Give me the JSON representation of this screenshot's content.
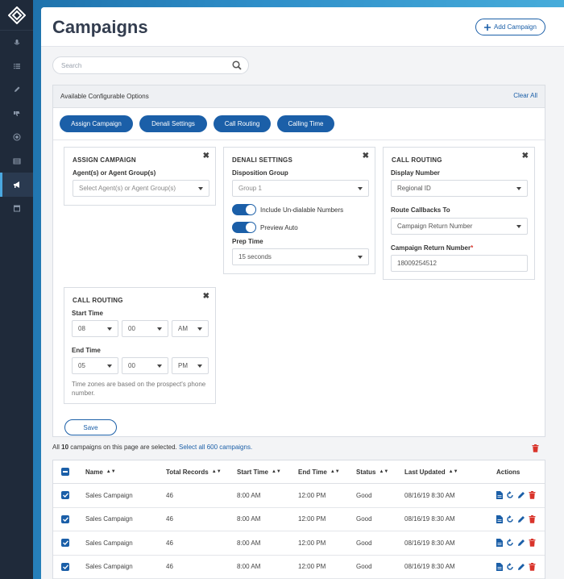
{
  "app": {
    "page_title": "Campaigns",
    "add_button_label": "Add Campaign"
  },
  "sidebar": {
    "items": [
      {
        "icon": "mic-icon"
      },
      {
        "icon": "list-icon"
      },
      {
        "icon": "pencil-icon"
      },
      {
        "icon": "thumbs-down-icon"
      },
      {
        "icon": "target-icon"
      },
      {
        "icon": "table-icon"
      },
      {
        "icon": "megaphone-icon",
        "active": true
      },
      {
        "icon": "calendar-icon"
      }
    ]
  },
  "search": {
    "placeholder": "Search"
  },
  "config": {
    "title": "Available Configurable Options",
    "clear_all": "Clear All",
    "pills": [
      "Assign Campaign",
      "Denali Settings",
      "Call Routing",
      "Calling Time"
    ],
    "assign_card": {
      "title": "ASSIGN CAMPAIGN",
      "label": "Agent(s) or Agent Group(s)",
      "select_placeholder": "Select Agent(s) or Agent Group(s)"
    },
    "denali_card": {
      "title": "DENALI SETTINGS",
      "disposition_label": "Disposition Group",
      "disposition_value": "Group 1",
      "toggle1_label": "Include Un-dialable Numbers",
      "toggle2_label": "Preview Auto",
      "prep_label": "Prep Time",
      "prep_value": "15 seconds"
    },
    "routing_card": {
      "title": "CALL ROUTING",
      "display_label": "Display Number",
      "display_value": "Regional ID",
      "callbacks_label": "Route Callbacks To",
      "callbacks_value": "Campaign Return Number",
      "return_label": "Campaign Return Number",
      "required_mark": "*",
      "return_value": "18009254512"
    },
    "time_card": {
      "title": "CALL ROUTING",
      "start_label": "Start Time",
      "start": [
        "08",
        "00",
        "AM"
      ],
      "end_label": "End Time",
      "end": [
        "05",
        "00",
        "PM"
      ],
      "note": "Time zones are based on the prospect's phone number."
    },
    "save_label": "Save"
  },
  "selection": {
    "prefix": "All ",
    "count": "10",
    "suffix": " campaigns on this page are selected. ",
    "select_all_link": "Select all 600 campaigns."
  },
  "table": {
    "columns": [
      "Name",
      "Total Records",
      "Start Time",
      "End Time",
      "Status",
      "Last Updated",
      "Actions"
    ],
    "rows": [
      {
        "name": "Sales Campaign",
        "records": "46",
        "start": "8:00 AM",
        "end": "12:00 PM",
        "status": "Good",
        "updated": "08/16/19 8:30 AM"
      },
      {
        "name": "Sales Campaign",
        "records": "46",
        "start": "8:00 AM",
        "end": "12:00 PM",
        "status": "Good",
        "updated": "08/16/19 8:30 AM"
      },
      {
        "name": "Sales Campaign",
        "records": "46",
        "start": "8:00 AM",
        "end": "12:00 PM",
        "status": "Good",
        "updated": "08/16/19 8:30 AM"
      },
      {
        "name": "Sales Campaign",
        "records": "46",
        "start": "8:00 AM",
        "end": "12:00 PM",
        "status": "Good",
        "updated": "08/16/19 8:30 AM"
      }
    ]
  },
  "colors": {
    "primary": "#1b5fa8",
    "danger": "#d9342b",
    "sidebar": "#1f2a3a"
  }
}
